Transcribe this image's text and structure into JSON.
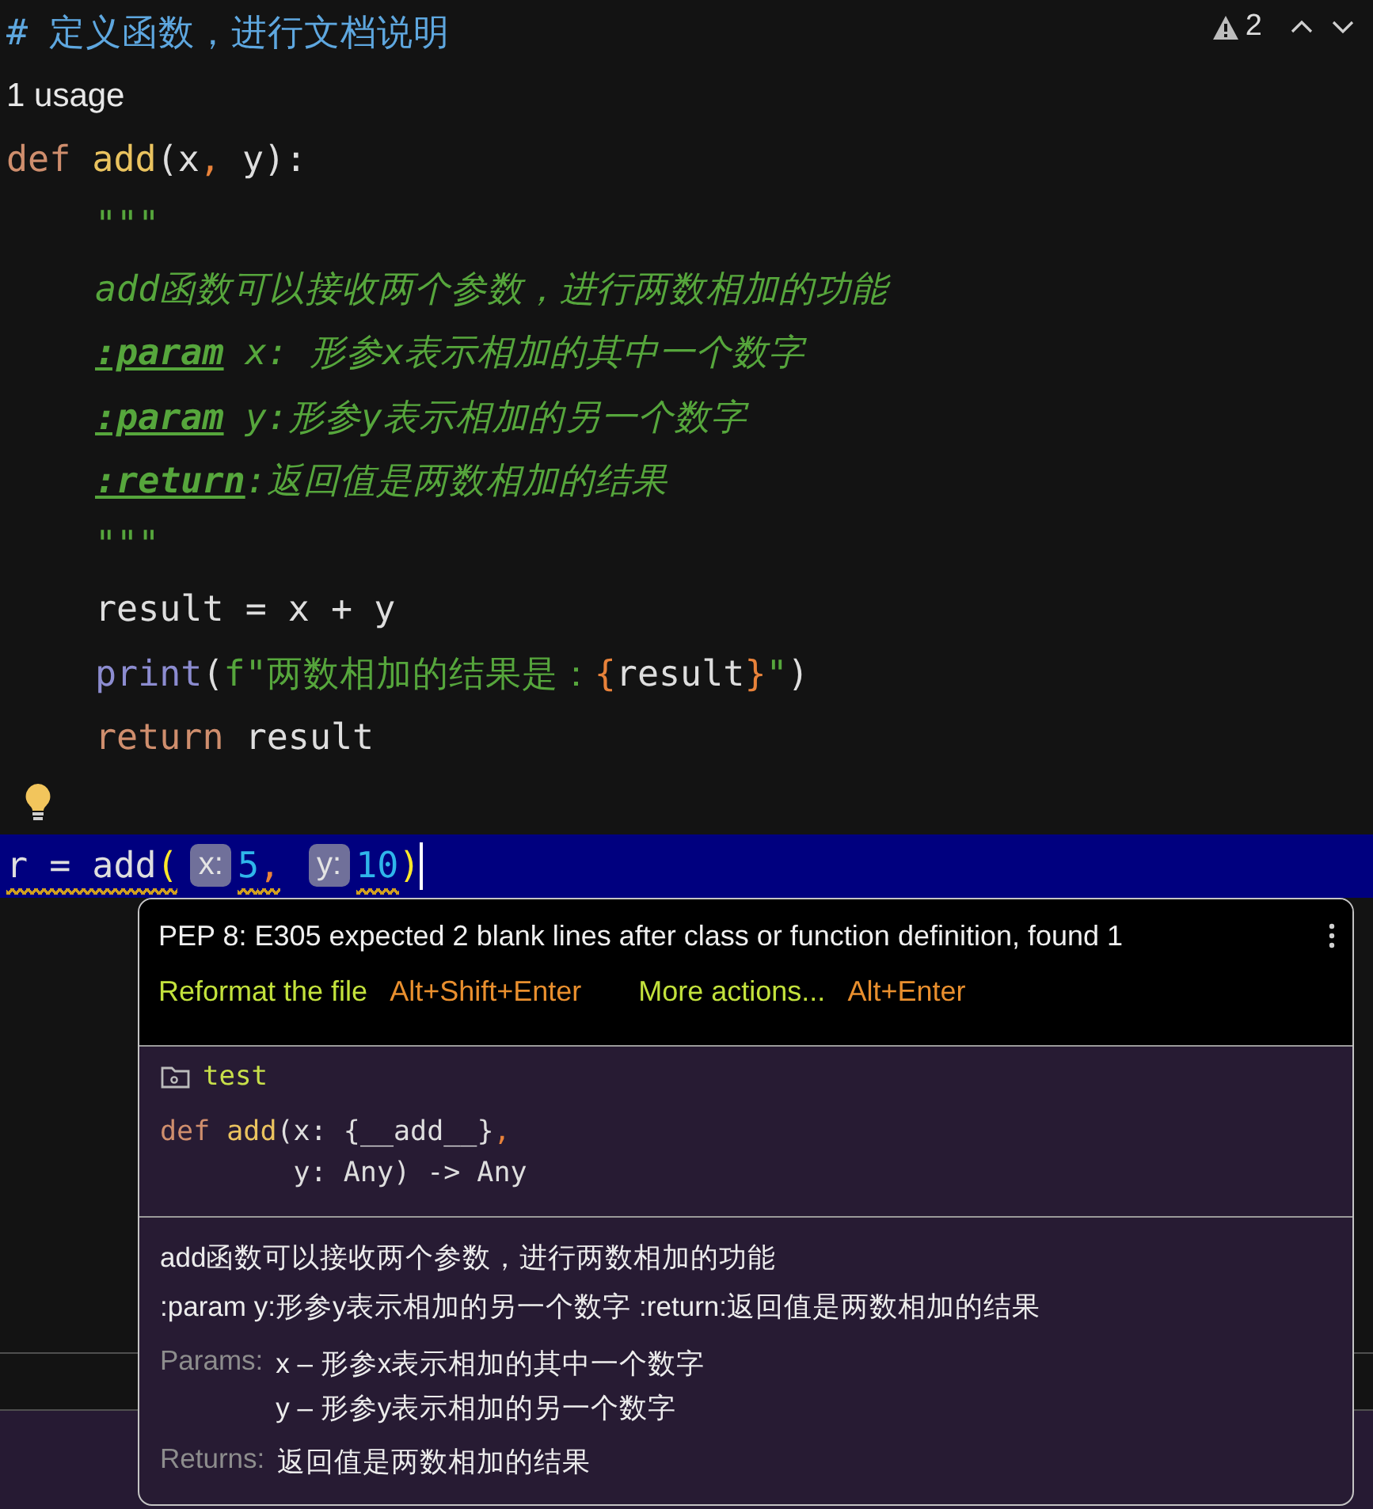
{
  "editor": {
    "inspection_widget": {
      "count": "2"
    },
    "lines": [
      {
        "kind": "code",
        "tokens": [
          {
            "text": "# 定义函数，进行文档说明",
            "kind": "comment"
          }
        ]
      },
      {
        "kind": "usage",
        "text": "1 usage"
      },
      {
        "kind": "code",
        "tokens": [
          {
            "text": "def",
            "kind": "keyword"
          },
          {
            "text": " add",
            "kind": "fn"
          },
          {
            "text": "(x",
            "kind": "plain"
          },
          {
            "text": ",",
            "kind": "comma"
          },
          {
            "text": " y):",
            "kind": "plain"
          }
        ],
        "children": [
          {
            "kind": "code",
            "tokens": [
              {
                "text": "\"\"\"",
                "kind": "doc"
              }
            ]
          },
          {
            "kind": "code",
            "tokens": [
              {
                "text": "add函数可以接收两个参数，进行两数相加的功能",
                "kind": "doc"
              }
            ]
          },
          {
            "kind": "code",
            "tokens": [
              {
                "text": ":param",
                "kind": "doctag"
              },
              {
                "text": " x: 形参x表示相加的其中一个数字",
                "kind": "doc"
              }
            ]
          },
          {
            "kind": "code",
            "tokens": [
              {
                "text": ":param",
                "kind": "doctag"
              },
              {
                "text": " y:形参y表示相加的另一个数字",
                "kind": "doc"
              }
            ]
          },
          {
            "kind": "code",
            "tokens": [
              {
                "text": ":return",
                "kind": "doctag"
              },
              {
                "text": ":返回值是两数相加的结果",
                "kind": "doc"
              }
            ]
          },
          {
            "kind": "code",
            "tokens": [
              {
                "text": "\"\"\"",
                "kind": "doc"
              }
            ]
          },
          {
            "kind": "code",
            "tokens": [
              {
                "text": "result = x + y",
                "kind": "plain"
              }
            ]
          },
          {
            "kind": "code",
            "tokens": [
              {
                "text": "print",
                "kind": "builtin"
              },
              {
                "text": "(",
                "kind": "plain"
              },
              {
                "text": "f\"两数相加的结果是：",
                "kind": "string"
              },
              {
                "text": "{",
                "kind": "brace"
              },
              {
                "text": "result",
                "kind": "plain"
              },
              {
                "text": "}",
                "kind": "brace"
              },
              {
                "text": "\"",
                "kind": "string"
              },
              {
                "text": ")",
                "kind": "plain"
              }
            ]
          },
          {
            "kind": "code",
            "tokens": [
              {
                "text": "return",
                "kind": "keyword"
              },
              {
                "text": " result",
                "kind": "plain"
              }
            ]
          }
        ]
      },
      {
        "kind": "bulb"
      }
    ],
    "current_line": {
      "parts": [
        {
          "kind": "code",
          "tokens": [
            {
              "text": "r = add",
              "kind": "plain",
              "warn": true
            },
            {
              "text": "(",
              "kind": "paren",
              "warn": true
            }
          ]
        },
        {
          "kind": "hint",
          "text": "x:"
        },
        {
          "kind": "code",
          "tokens": [
            {
              "text": "5",
              "kind": "number",
              "warn": true
            },
            {
              "text": ",",
              "kind": "comma",
              "warn": true
            }
          ]
        },
        {
          "kind": "hint",
          "text": "y:"
        },
        {
          "kind": "code",
          "tokens": [
            {
              "text": "10",
              "kind": "number",
              "warn": true
            },
            {
              "text": ")",
              "kind": "paren",
              "warn": false
            }
          ]
        }
      ]
    }
  },
  "popup": {
    "message": "PEP 8: E305 expected 2 blank lines after class or function definition, found 1",
    "actions": [
      {
        "label": "Reformat the file",
        "shortcut": "Alt+Shift+Enter"
      },
      {
        "label": "More actions...",
        "shortcut": "Alt+Enter"
      }
    ],
    "module": "test",
    "signature_lines": [
      [
        {
          "text": "def",
          "kind": "keyword"
        },
        {
          "text": " add",
          "kind": "fn"
        },
        {
          "text": "(x: {__add__}",
          "kind": "plain"
        },
        {
          "text": ",",
          "kind": "comma"
        }
      ],
      [
        {
          "text": "        y: Any) -> Any",
          "kind": "plain"
        }
      ]
    ],
    "description_lines": [
      "add函数可以接收两个参数，进行两数相加的功能",
      ":param y:形参y表示相加的另一个数字 :return:返回值是两数相加的结果"
    ],
    "sections": [
      {
        "label": "Params:",
        "items": [
          "x – 形参x表示相加的其中一个数字",
          "y – 形参y表示相加的另一个数字"
        ]
      },
      {
        "label": "Returns:",
        "items": [
          "返回值是两数相加的结果"
        ]
      }
    ]
  }
}
